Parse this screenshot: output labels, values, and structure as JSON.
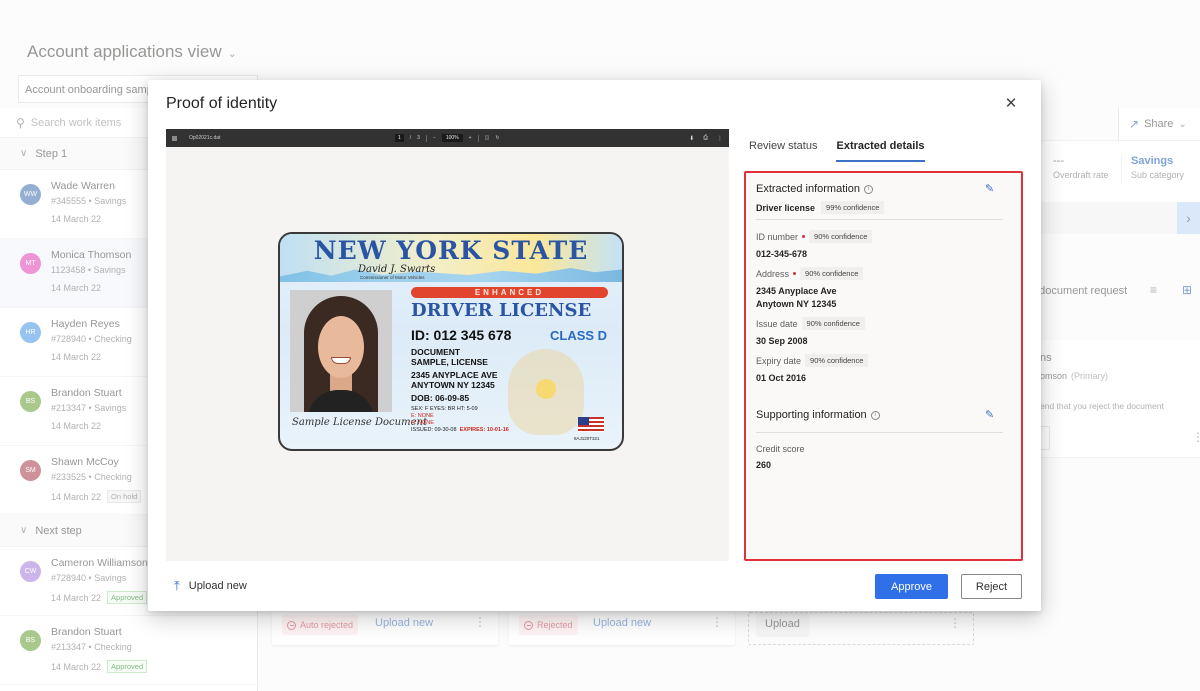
{
  "app": {
    "view_title": "Account applications view",
    "filter_value": "Account onboarding samples",
    "search_placeholder": "Search work items",
    "share_label": "Share",
    "steps": [
      {
        "label": "Step 1",
        "items": [
          {
            "initials": "WW",
            "name": "Wade Warren",
            "sub": "#345555 • Savings",
            "date": "14 March 22",
            "badge": "",
            "color": "#5b84b8"
          },
          {
            "initials": "MT",
            "name": "Monica Thomson",
            "sub": "1123458 • Savings",
            "date": "14 March 22",
            "badge": "",
            "color": "#e35dbd"
          },
          {
            "initials": "HR",
            "name": "Hayden Reyes",
            "sub": "#728940 • Checking",
            "date": "14 March 22",
            "badge": "",
            "color": "#5ea5e8"
          },
          {
            "initials": "BS",
            "name": "Brandon Stuart",
            "sub": "#213347 • Savings",
            "date": "14 March 22",
            "badge": "",
            "color": "#7aad4d"
          },
          {
            "initials": "SM",
            "name": "Shawn McCoy",
            "sub": "#233525 • Checking",
            "date": "14 March 22",
            "badge": "On hold",
            "color": "#b35864"
          }
        ]
      },
      {
        "label": "Next step",
        "items": [
          {
            "initials": "CW",
            "name": "Cameron Williamson",
            "sub": "#728940 • Savings",
            "date": "14 March 22",
            "badge": "Approved",
            "color": "#b18ee0"
          },
          {
            "initials": "BS",
            "name": "Brandon Stuart",
            "sub": "#213347 • Checking",
            "date": "14 March 22",
            "badge": "Approved",
            "color": "#7aad4d"
          }
        ]
      }
    ],
    "metrics": [
      {
        "value": "---",
        "label": "Overdraft rate"
      },
      {
        "value": "Savings",
        "label": "Sub category"
      }
    ],
    "doc_request_label": "d document request",
    "right_card": {
      "title": "ns",
      "person": "omson",
      "role": "(Primary)",
      "note": "end that you reject the document"
    },
    "doc_cards": [
      {
        "status": "Auto rejected",
        "action": "Upload new"
      },
      {
        "status": "Rejected",
        "action": "Upload new"
      },
      {
        "status": "",
        "action": "Upload"
      }
    ]
  },
  "modal": {
    "title": "Proof of identity",
    "viewer": {
      "file_name": "Op02021c.dat",
      "page_current": "1",
      "page_total": "3",
      "zoom": "100%"
    },
    "license": {
      "state": "NEW YORK STATE",
      "signature": "David J. Swarts",
      "commissioner": "Commissioner of Motor Vehicles",
      "enhanced": "ENHANCED",
      "title": "DRIVER LICENSE",
      "id": "ID: 012 345 678",
      "class": "CLASS D",
      "line1": "DOCUMENT",
      "line2": "SAMPLE, LICENSE",
      "line3": "2345 ANYPLACE AVE",
      "line4": "ANYTOWN NY  12345",
      "dob": "DOB:  06-09-85",
      "sex_eyes_ht": "SEX: F   EYES: BR   HT: 5-09",
      "e": "E: NONE",
      "r": "R: NONE",
      "issued": "ISSUED: 09-30-08",
      "expires": "EXPIRES: 10-01-16",
      "photo_signature": "Sample License Document",
      "code": "8AJ120T321"
    },
    "tabs": [
      {
        "label": "Review status",
        "active": false
      },
      {
        "label": "Extracted details",
        "active": true
      }
    ],
    "extracted": {
      "heading": "Extracted information",
      "doc_type": "Driver license",
      "doc_confidence": "99% confidence",
      "fields": [
        {
          "label": "ID number",
          "required": true,
          "confidence": "90% confidence",
          "value": "012-345-678"
        },
        {
          "label": "Address",
          "required": true,
          "confidence": "90% confidence",
          "value": "2345 Anyplace Ave\nAnytown NY 12345"
        },
        {
          "label": "Issue date",
          "required": false,
          "confidence": "90% confidence",
          "value": "30 Sep 2008"
        },
        {
          "label": "Expiry date",
          "required": false,
          "confidence": "90% confidence",
          "value": "01 Oct 2016"
        }
      ]
    },
    "supporting": {
      "heading": "Supporting information",
      "fields": [
        {
          "label": "Credit score",
          "value": "260"
        }
      ]
    },
    "footer": {
      "upload_label": "Upload new",
      "approve_label": "Approve",
      "reject_label": "Reject"
    },
    "colors": {
      "accent": "#2f6fe8",
      "highlight_border": "#e0303a"
    }
  }
}
